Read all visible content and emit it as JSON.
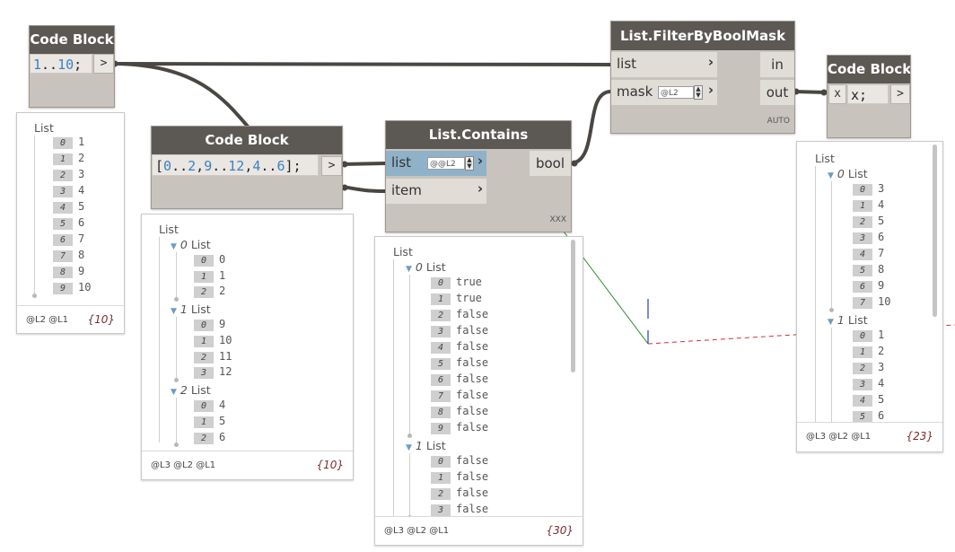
{
  "nodes": {
    "cb1": {
      "title": "Code Block",
      "code_num1": "1",
      "code_op": "..",
      "code_num2": "10",
      "code_end": ";",
      "out": ">"
    },
    "cb2": {
      "title": "Code Block",
      "code": [
        {
          "t": "[",
          "c": "p"
        },
        {
          "t": "0",
          "c": "n"
        },
        {
          "t": "..",
          "c": "p"
        },
        {
          "t": "2",
          "c": "n"
        },
        {
          "t": ",",
          "c": "p"
        },
        {
          "t": "9",
          "c": "n"
        },
        {
          "t": "..",
          "c": "p"
        },
        {
          "t": "12",
          "c": "n"
        },
        {
          "t": ",",
          "c": "p"
        },
        {
          "t": "4",
          "c": "n"
        },
        {
          "t": "..",
          "c": "p"
        },
        {
          "t": "6",
          "c": "n"
        },
        {
          "t": "];",
          "c": "p"
        }
      ],
      "out": ">"
    },
    "contains": {
      "title": "List.Contains",
      "in1": "list",
      "in1_level": "@@L2",
      "in2": "item",
      "out": "bool",
      "lacing": "XXX"
    },
    "filter": {
      "title": "List.FilterByBoolMask",
      "in1": "list",
      "in2": "mask",
      "in2_level": "@L2",
      "out1": "in",
      "out2": "out",
      "lacing": "AUTO"
    },
    "cb3": {
      "title": "Code Block",
      "in": "x",
      "code": "x;",
      "out": ">"
    }
  },
  "previews": {
    "p1": {
      "header": "List",
      "items": [
        [
          "0",
          "1"
        ],
        [
          "1",
          "2"
        ],
        [
          "2",
          "3"
        ],
        [
          "3",
          "4"
        ],
        [
          "4",
          "5"
        ],
        [
          "5",
          "6"
        ],
        [
          "6",
          "7"
        ],
        [
          "7",
          "8"
        ],
        [
          "8",
          "9"
        ],
        [
          "9",
          "10"
        ]
      ],
      "levels": "@L2 @L1",
      "count": "{10}"
    },
    "p2": {
      "header": "List",
      "groups": [
        {
          "idx": "0",
          "label": "List",
          "items": [
            [
              "0",
              "0"
            ],
            [
              "1",
              "1"
            ],
            [
              "2",
              "2"
            ]
          ]
        },
        {
          "idx": "1",
          "label": "List",
          "items": [
            [
              "0",
              "9"
            ],
            [
              "1",
              "10"
            ],
            [
              "2",
              "11"
            ],
            [
              "3",
              "12"
            ]
          ]
        },
        {
          "idx": "2",
          "label": "List",
          "items": [
            [
              "0",
              "4"
            ],
            [
              "1",
              "5"
            ],
            [
              "2",
              "6"
            ]
          ]
        }
      ],
      "levels": "@L3 @L2 @L1",
      "count": "{10}"
    },
    "p3": {
      "header": "List",
      "groups": [
        {
          "idx": "0",
          "label": "List",
          "items": [
            [
              "0",
              "true"
            ],
            [
              "1",
              "true"
            ],
            [
              "2",
              "false"
            ],
            [
              "3",
              "false"
            ],
            [
              "4",
              "false"
            ],
            [
              "5",
              "false"
            ],
            [
              "6",
              "false"
            ],
            [
              "7",
              "false"
            ],
            [
              "8",
              "false"
            ],
            [
              "9",
              "false"
            ]
          ]
        },
        {
          "idx": "1",
          "label": "List",
          "items": [
            [
              "0",
              "false"
            ],
            [
              "1",
              "false"
            ],
            [
              "2",
              "false"
            ],
            [
              "3",
              "false"
            ]
          ]
        }
      ],
      "levels": "@L3 @L2 @L1",
      "count": "{30}"
    },
    "p4": {
      "header": "List",
      "groups": [
        {
          "idx": "0",
          "label": "List",
          "items": [
            [
              "0",
              "3"
            ],
            [
              "1",
              "4"
            ],
            [
              "2",
              "5"
            ],
            [
              "3",
              "6"
            ],
            [
              "4",
              "7"
            ],
            [
              "5",
              "8"
            ],
            [
              "6",
              "9"
            ],
            [
              "7",
              "10"
            ]
          ]
        },
        {
          "idx": "1",
          "label": "List",
          "items": [
            [
              "0",
              "1"
            ],
            [
              "1",
              "2"
            ],
            [
              "2",
              "3"
            ],
            [
              "3",
              "4"
            ],
            [
              "4",
              "5"
            ],
            [
              "5",
              "6"
            ]
          ]
        }
      ],
      "levels": "@L3 @L2 @L1",
      "count": "{23}"
    }
  },
  "colors": {
    "wire": "#4a4743",
    "node_header": "#5c5955",
    "node_body": "#c8c3bd",
    "number": "#3b82c4",
    "selected_port": "#8fb2c8",
    "dashed_line": "#d0303a",
    "green_line": "#2e8b2e",
    "blue_line": "#2c4fc9"
  }
}
